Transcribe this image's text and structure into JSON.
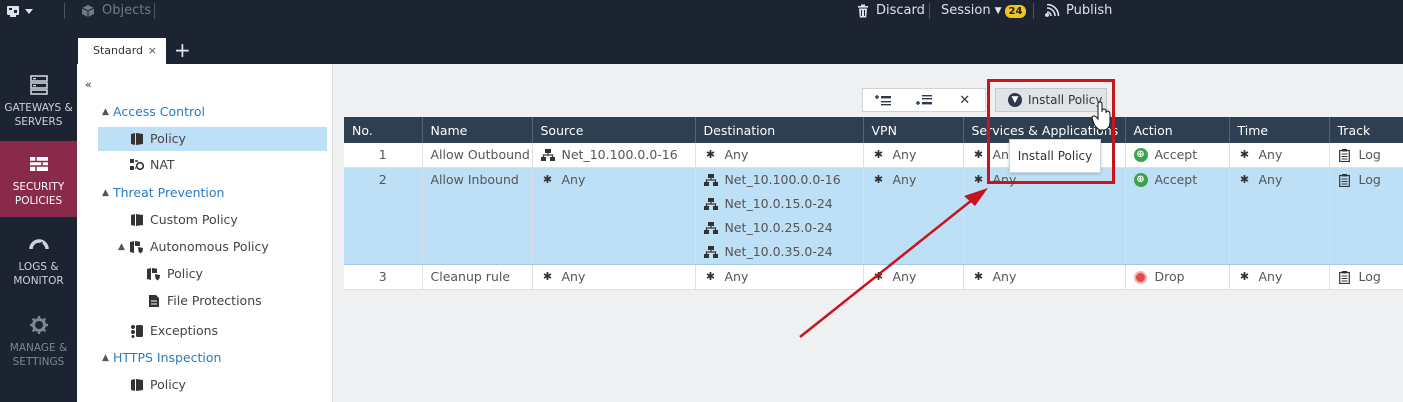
{
  "topbar": {
    "objects_label": "Objects",
    "discard_label": "Discard",
    "session_label": "Session",
    "session_count": "24",
    "publish_label": "Publish"
  },
  "tabs": [
    {
      "label": "Standard",
      "close": "×"
    }
  ],
  "new_tab_label": "+",
  "leftnav": [
    {
      "label": "GATEWAYS & SERVERS",
      "icon": "gateways-icon"
    },
    {
      "label": "SECURITY POLICIES",
      "icon": "security-policies-icon",
      "active": true
    },
    {
      "label": "LOGS & MONITOR",
      "icon": "gauge-icon"
    },
    {
      "label": "MANAGE & SETTINGS",
      "icon": "gear-icon"
    }
  ],
  "tree": {
    "collapse_glyph": "«",
    "items": [
      {
        "label": "Access Control",
        "type": "category"
      },
      {
        "label": "Policy",
        "icon": "policy-icon",
        "selected": true
      },
      {
        "label": "NAT",
        "icon": "nat-icon"
      },
      {
        "label": "Threat Prevention",
        "type": "category"
      },
      {
        "label": "Custom Policy",
        "icon": "policy-icon"
      },
      {
        "label": "Autonomous Policy",
        "icon": "autonomous-policy-icon"
      },
      {
        "label": "Policy",
        "icon": "autonomous-policy-icon"
      },
      {
        "label": "File Protections",
        "icon": "file-icon"
      },
      {
        "label": "Exceptions",
        "icon": "exceptions-icon"
      },
      {
        "label": "HTTPS Inspection",
        "type": "category"
      },
      {
        "label": "Policy",
        "icon": "policy-icon"
      }
    ]
  },
  "toolbar": {
    "delete_glyph": "✕",
    "install_label": "Install Policy",
    "tooltip": "Install Policy"
  },
  "table": {
    "columns": [
      "No.",
      "Name",
      "Source",
      "Destination",
      "VPN",
      "Services & Applications",
      "Action",
      "Time",
      "Track"
    ],
    "rows": [
      {
        "no": "1",
        "name": "Allow Outbound",
        "source": [
          "Net_10.100.0.0-16"
        ],
        "destination": [
          "Any"
        ],
        "vpn": "Any",
        "services": "Any",
        "action": "Accept",
        "time": "Any",
        "track": "Log"
      },
      {
        "no": "2",
        "name": "Allow Inbound",
        "source": [
          "Any"
        ],
        "destination": [
          "Net_10.100.0.0-16",
          "Net_10.0.15.0-24",
          "Net_10.0.25.0-24",
          "Net_10.0.35.0-24"
        ],
        "vpn": "Any",
        "services": "Any",
        "action": "Accept",
        "time": "Any",
        "track": "Log",
        "highlighted": true
      },
      {
        "no": "3",
        "name": "Cleanup rule",
        "source": [
          "Any"
        ],
        "destination": [
          "Any"
        ],
        "vpn": "Any",
        "services": "Any",
        "action": "Drop",
        "time": "Any",
        "track": "Log"
      }
    ]
  },
  "colors": {
    "nav_bg": "#1b2430",
    "nav_active": "#8a2a4a",
    "header_bg": "#2f3f52",
    "selection": "#bde0f7",
    "link": "#2a7bc0",
    "annotation_red": "#c8141d",
    "accept": "#3ca34a",
    "drop": "#e24a4a",
    "session_badge": "#f2c318"
  }
}
